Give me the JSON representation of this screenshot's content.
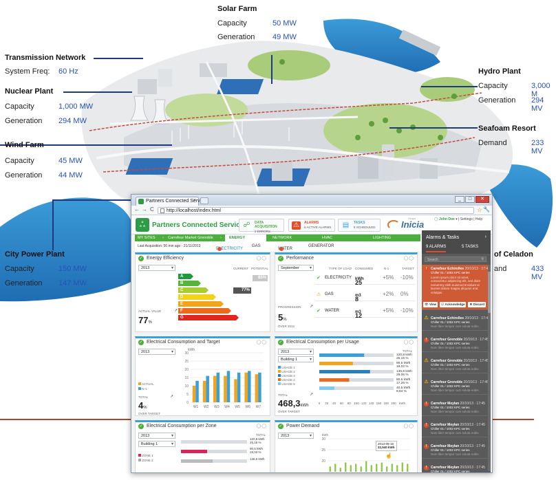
{
  "city": {
    "solar_farm": {
      "title": "Solar Farm",
      "capacity_label": "Capacity",
      "capacity": "50 MW",
      "generation_label": "Generation",
      "generation": "49 MW"
    },
    "transmission": {
      "title": "Transmission Network",
      "freq_label": "System Freq:",
      "freq": "60 Hz"
    },
    "nuclear": {
      "title": "Nuclear Plant",
      "capacity_label": "Capacity",
      "capacity": "1,000 MW",
      "generation_label": "Generation",
      "generation": "294 MW"
    },
    "wind": {
      "title": "Wind Farm",
      "capacity_label": "Capacity",
      "capacity": "45 MW",
      "generation_label": "Generation",
      "generation": "44 MW"
    },
    "city_power": {
      "title": "City Power Plant",
      "capacity_label": "Capacity",
      "capacity": "150 MW",
      "generation_label": "Generation",
      "generation": "147 MW"
    },
    "hydro": {
      "title": "Hydro Plant",
      "capacity_label": "Capacity",
      "capacity": "3,000 M",
      "generation_label": "Generation",
      "generation": "294 MV"
    },
    "seafoam": {
      "title": "Seafoam Resort",
      "demand_label": "Demand",
      "demand": "233 MV"
    },
    "celadon": {
      "title": "of Celadon",
      "demand_label": "and",
      "demand": "433 MV"
    }
  },
  "browser": {
    "tab_title": "Partners Connected Services",
    "tab_close": "×",
    "back": "←",
    "forward": "→",
    "reload": "C",
    "url": "http://localhost/index.html",
    "star": "☆",
    "wrench": "🔧",
    "min": "_",
    "max": "□",
    "close": "✕"
  },
  "app": {
    "logo_glyph": "ஃ",
    "brand": "Partners Connected Services",
    "chips": [
      {
        "icon": "☍",
        "title": "DATA ACQUISITION",
        "sub": "2 ERRORS"
      },
      {
        "icon": "⚠",
        "title": "ALARMS",
        "sub": "6 ACTIVE ALARMS"
      },
      {
        "icon": "▤",
        "title": "TASKS",
        "sub": "5 SCHEDULED"
      }
    ],
    "inicia_small": "Grupo",
    "inicia": "Inicia",
    "user": "John Doe",
    "user_links": "Settings | Help"
  },
  "nav": {
    "items": [
      "MY SITES",
      "Carrefour Market Grenoble",
      "ENERGY",
      "NETWORK",
      "HVAC",
      "LIGHTING"
    ],
    "sep": "›",
    "last_acq": "Last Acquisition: 56 min ago - 21/11/2013",
    "sub": [
      "ELECTRICITY",
      "GAS",
      "WATER",
      "GENERATOR"
    ],
    "electricity_badge": "!",
    "water_badge": "!"
  },
  "energy_eff": {
    "title": "Energy Efficiency",
    "year": "2013",
    "col_current": "CURRENT",
    "col_potential": "POTENTIAL",
    "classes": [
      {
        "letter": "A",
        "color": "#1f9a3a"
      },
      {
        "letter": "B",
        "color": "#57b43a"
      },
      {
        "letter": "C",
        "color": "#a9cc2f"
      },
      {
        "letter": "D",
        "color": "#f2d21c"
      },
      {
        "letter": "E",
        "color": "#f2a41c"
      },
      {
        "letter": "F",
        "color": "#ec6a1e"
      },
      {
        "letter": "G",
        "color": "#e2261f"
      }
    ],
    "current": "77%",
    "potential": "85%",
    "actual_label": "ACTUAL VALUE",
    "actual_value": "77",
    "actual_unit": "%",
    "arrow": "↗"
  },
  "performance": {
    "title": "Performance",
    "month": "September",
    "cols": [
      "TYPE OF LOAD",
      "CONSUMED",
      "N-1",
      "TARGET"
    ],
    "rows": [
      {
        "status": "ok",
        "type": "ELECTRICITY",
        "consumed": "25",
        "unit": "kWh",
        "n1": "+5%",
        "target": "-10%"
      },
      {
        "status": "warn",
        "type": "GAS",
        "consumed": "8",
        "unit": "m3",
        "n1": "+2%",
        "target": "0%"
      },
      {
        "status": "ok",
        "type": "WATER",
        "consumed": "12",
        "unit": "m3",
        "n1": "+5%",
        "target": "-10%"
      }
    ],
    "progression_label": "PROGRESSION",
    "progression": "5",
    "progression_unit": "%",
    "progression_sub": "OVER 2012",
    "arrow": "↗"
  },
  "consumption_target": {
    "title": "Electrical Consumption and Target",
    "year": "2013",
    "legend": [
      "ACTUAL",
      "N-1"
    ],
    "total_label": "TOTAL",
    "total": "4",
    "total_unit": "%",
    "total_sub": "OVER TARGET",
    "arrow": "↗"
  },
  "consumption_usage": {
    "title": "Electrical Consumption per Usage",
    "year": "2013",
    "building": "Building 1",
    "legend": [
      "USAGE 1",
      "USAGE 2",
      "USAGE 3",
      "USAGE 4",
      "USAGE 5"
    ],
    "total_col": "TOTAL",
    "totals": [
      "120,8 kWh\n25,15 %",
      "90,5 kWh\n19,02 %",
      "136,6 kWh\n29,06 %",
      "80,5 kWh\n17,26 %",
      "40,5 kWh\n8,64 %"
    ],
    "total_label": "TOTAL",
    "total": "468,3",
    "total_unit": "kWh",
    "total_sub": "OVER TARGET",
    "arrow": "↗"
  },
  "consumption_zone": {
    "title": "Electrical Consumption per Zone",
    "year": "2013",
    "building": "Building 1",
    "total_col": "TOTAL",
    "legend": [
      "ZONE 1",
      "ZONE 2"
    ],
    "totals": [
      "120,8 kWh\n25,15 %",
      "90,5 kWh\n19,02 %",
      "136,6 kWh"
    ]
  },
  "power_demand": {
    "title": "Power Demand",
    "year": "2013",
    "unit": "kWh",
    "tooltip_date": "2013-09-16",
    "tooltip_value": "22,540 kWh"
  },
  "alarms": {
    "title": "Alarms & Tasks",
    "tab_alarms": "9 ALARMS",
    "tab_tasks": "5 TASKS",
    "search_placeholder": "Search",
    "first_desc": "Lorem ipsum dolor sit amet, consectetur adipiscing elit, sed diam nonummy nibh euismod tincidunt ut laoreet dolore magna aliquam erat volutpat.",
    "actions": [
      "View",
      "Acknowledge",
      "Discard"
    ],
    "items": [
      {
        "type": "alarm",
        "site": "Carrefour Echirolles",
        "date": "20/10/13 · 17:45",
        "equip": "Chiller 01 / 1002 KPC series",
        "desc": ""
      },
      {
        "type": "warn",
        "site": "Carrefour Echirolles",
        "date": "20/10/13 · 17:45",
        "equip": "Chiller 01 / 1002 KPC series",
        "desc": "Nam liber tempor cum soluta nobis."
      },
      {
        "type": "alarm",
        "site": "Carrefour Grenoble",
        "date": "20/10/13 · 17:45",
        "equip": "Chiller 01 / 1002 KPC series",
        "desc": "Nam liber tempor cum soluta nobis."
      },
      {
        "type": "warn",
        "site": "Carrefour Grenoble",
        "date": "20/10/13 · 17:45",
        "equip": "Chiller 01 / 1002 KPC series",
        "desc": "Nam liber tempor cum soluta nobis."
      },
      {
        "type": "warn",
        "site": "Carrefour Grenoble",
        "date": "20/10/13 · 17:45",
        "equip": "Chiller 01 / 1002 KPC series",
        "desc": "Nam liber tempor cum soluta nobis."
      },
      {
        "type": "alarm",
        "site": "Carrefour Meylan",
        "date": "20/10/13 · 17:45",
        "equip": "Chiller 01 / 1002 KPC series",
        "desc": "Nam liber tempor cum soluta nobis."
      },
      {
        "type": "alarm",
        "site": "Carrefour Meylan",
        "date": "20/10/13 · 17:45",
        "equip": "Chiller 01 / 1002 KPC series",
        "desc": "Nam liber tempor cum soluta nobis."
      },
      {
        "type": "alarm",
        "site": "Carrefour Meylan",
        "date": "20/10/13 · 17:45",
        "equip": "Chiller 01 / 1002 KPC series",
        "desc": "Nam liber tempor cum soluta nobis."
      },
      {
        "type": "alarm",
        "site": "Carrefour Meylan",
        "date": "20/10/13 · 17:45",
        "equip": "Chiller 01 / 1002 KPC series",
        "desc": "Nam liber tempor cum soluta nobis."
      }
    ]
  },
  "chart_data": [
    {
      "type": "bar",
      "categories": [
        "W1",
        "W2",
        "W3",
        "W4",
        "W5",
        "W6",
        "W7"
      ],
      "series": [
        {
          "name": "ACTUAL",
          "values": [
            10,
            13,
            16,
            16,
            14,
            18,
            17
          ]
        },
        {
          "name": "N-1",
          "values": [
            13,
            16,
            18,
            19,
            18,
            19,
            18
          ]
        }
      ],
      "ylabel": "kWh",
      "ylim": [
        0,
        30
      ],
      "yticks": [
        0,
        5,
        10,
        15,
        20,
        25,
        30
      ]
    },
    {
      "type": "bar",
      "orientation": "horizontal",
      "categories": [
        "USAGE 1",
        "USAGE 2",
        "USAGE 3",
        "USAGE 4",
        "USAGE 5"
      ],
      "values": [
        120.8,
        90.5,
        136.6,
        80.5,
        40.5
      ],
      "xlim": [
        0,
        200
      ],
      "xticks": [
        0,
        20,
        40,
        60,
        80,
        100,
        120,
        140,
        160,
        180,
        200
      ],
      "xlabel": "kWh",
      "colors": [
        "#3ba0d8",
        "#f2a41c",
        "#2a7fb8",
        "#ec6a1e",
        "#7fc8ee"
      ]
    },
    {
      "type": "bar",
      "categories": [
        "d1",
        "d2",
        "d3",
        "d4",
        "d5",
        "d6",
        "d7",
        "d8",
        "d9",
        "d10",
        "d11",
        "d12",
        "d13",
        "d14",
        "d15",
        "d16"
      ],
      "values": [
        14,
        16,
        13,
        17,
        15,
        16,
        14,
        18,
        15,
        16,
        17,
        14,
        16,
        15,
        17,
        16
      ],
      "ylabel": "kWh",
      "ylim": [
        0,
        30
      ],
      "yticks": [
        20,
        25,
        30
      ]
    }
  ]
}
